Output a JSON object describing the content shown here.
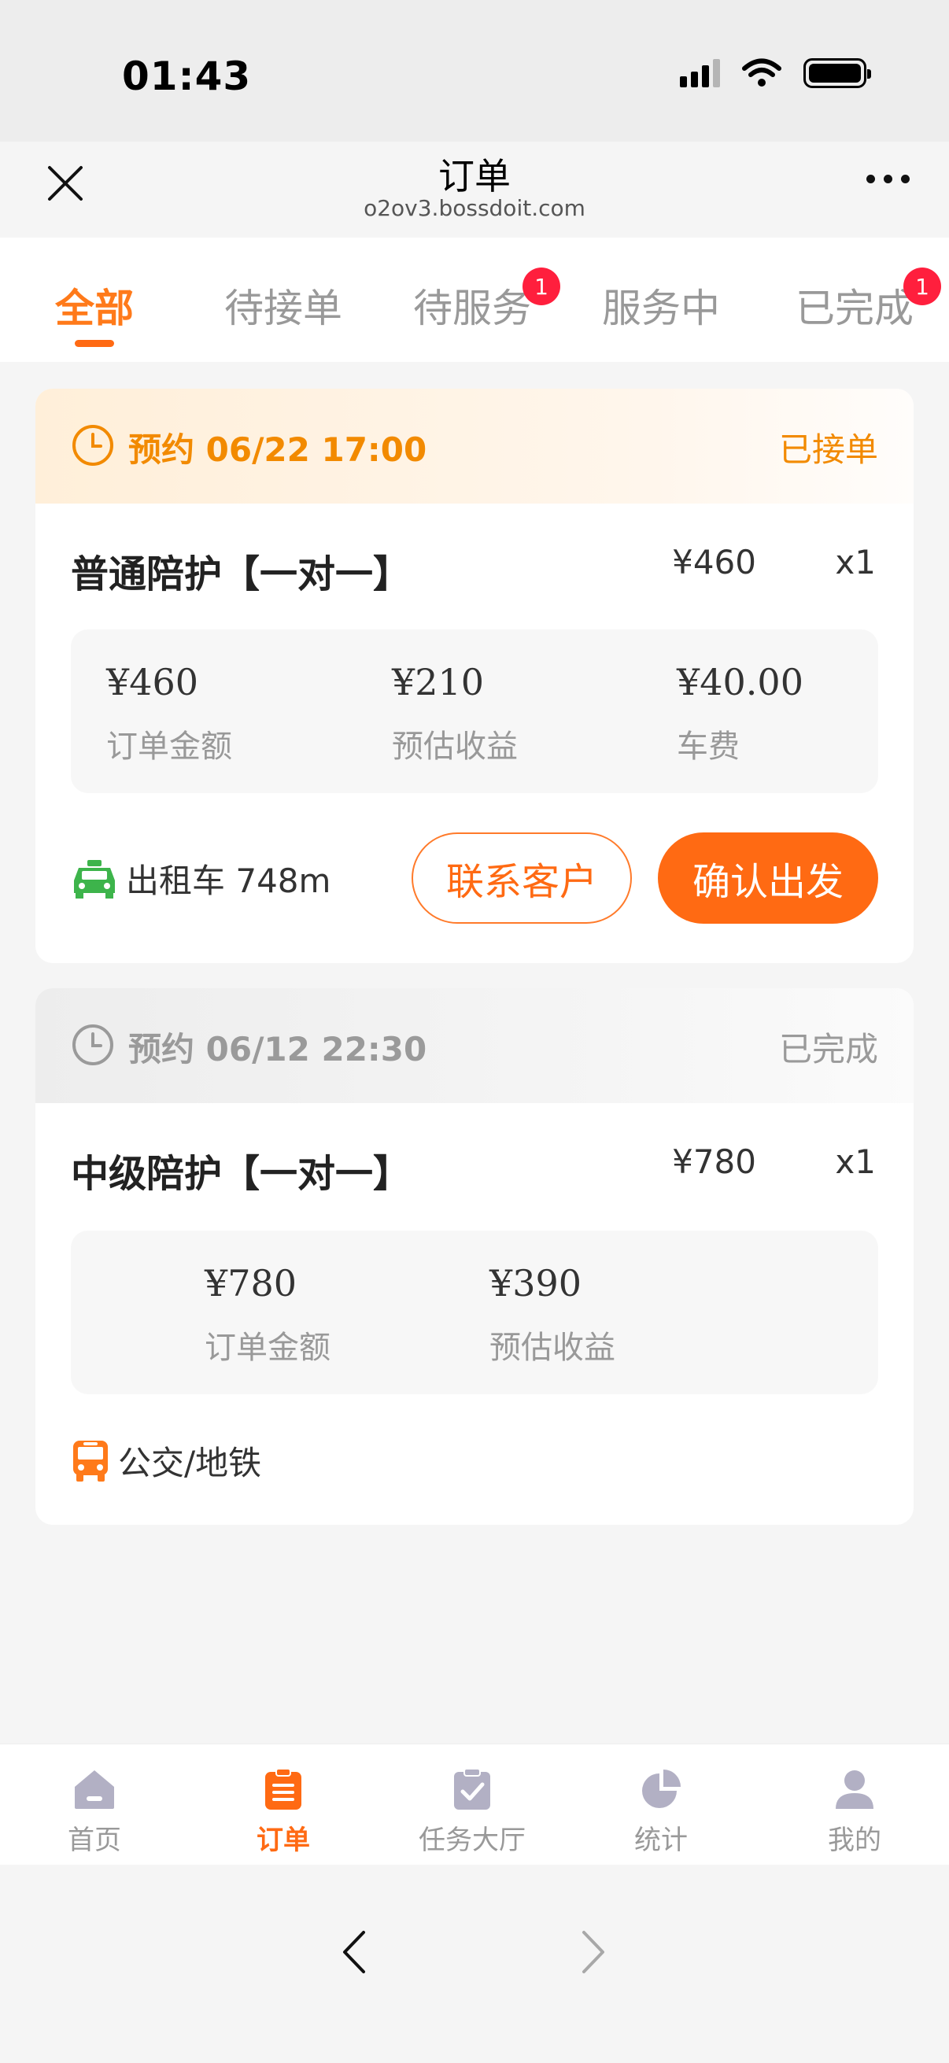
{
  "status_bar": {
    "time": "01:43"
  },
  "nav": {
    "title": "订单",
    "subtitle": "o2ov3.bossdoit.com"
  },
  "tabs": [
    {
      "label": "全部",
      "badge": null
    },
    {
      "label": "待接单",
      "badge": null
    },
    {
      "label": "待服务",
      "badge": "1"
    },
    {
      "label": "服务中",
      "badge": null
    },
    {
      "label": "已完成",
      "badge": "1"
    }
  ],
  "orders": [
    {
      "time": "预约 06/22 17:00",
      "status": "已接单",
      "service_name": "普通陪护【一对一】",
      "price": "¥460",
      "qty": "x1",
      "stats": [
        {
          "value": "¥460",
          "label": "订单金额"
        },
        {
          "value": "¥210",
          "label": "预估收益"
        },
        {
          "value": "¥40.00",
          "label": "车费"
        }
      ],
      "transport": "出租车 748m",
      "transport_icon": "taxi-icon",
      "actions": {
        "contact": "联系客户",
        "confirm": "确认出发"
      }
    },
    {
      "time": "预约 06/12 22:30",
      "status": "已完成",
      "service_name": "中级陪护【一对一】",
      "price": "¥780",
      "qty": "x1",
      "stats": [
        {
          "value": "¥780",
          "label": "订单金额"
        },
        {
          "value": "¥390",
          "label": "预估收益"
        }
      ],
      "transport": "公交/地铁",
      "transport_icon": "bus-icon"
    }
  ],
  "tabbar": [
    {
      "label": "首页",
      "icon": "home-icon"
    },
    {
      "label": "订单",
      "icon": "order-icon"
    },
    {
      "label": "任务大厅",
      "icon": "task-icon"
    },
    {
      "label": "统计",
      "icon": "pie-chart-icon"
    },
    {
      "label": "我的",
      "icon": "user-icon"
    }
  ],
  "colors": {
    "accent": "#ff6a13",
    "badge": "#ff1f3d",
    "taxi": "#3db44b",
    "bus": "#ff7a1a"
  }
}
